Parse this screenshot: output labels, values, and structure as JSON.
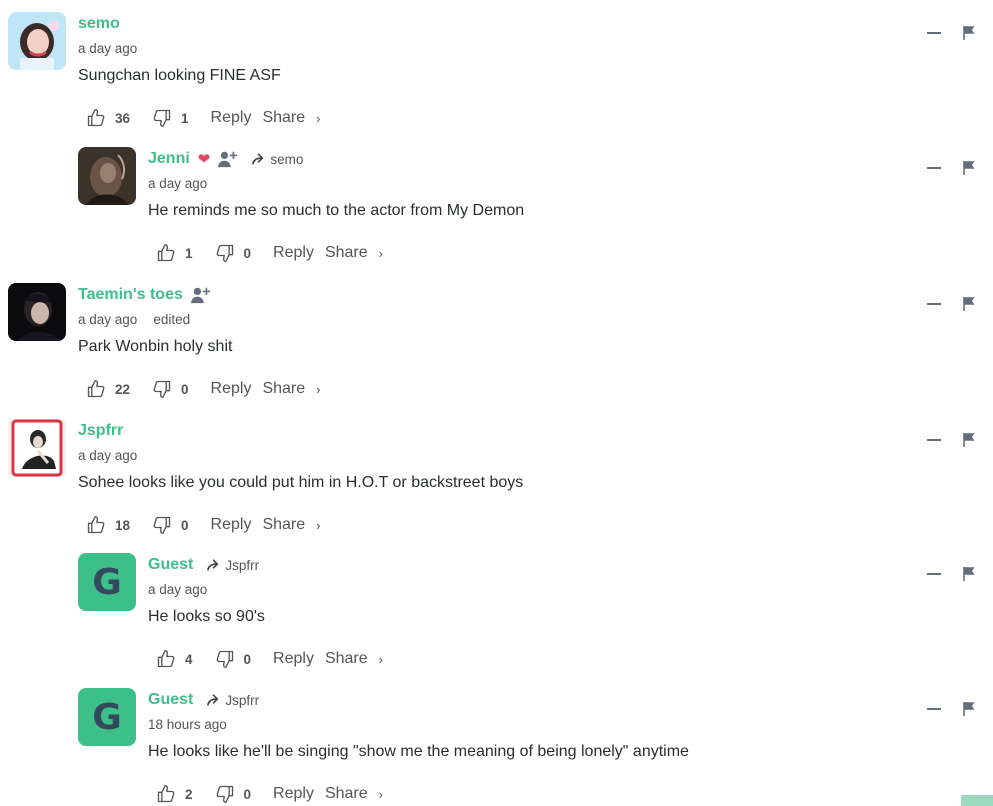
{
  "colors": {
    "author": "#3dbf8a",
    "text": "#2a2e2e",
    "muted": "#555555",
    "avatar_letter_bg": "#3dbf8a",
    "heart": "#e64563"
  },
  "labels": {
    "reply": "Reply",
    "share": "Share",
    "share_chevron": "›",
    "edited": "edited"
  },
  "comments": [
    {
      "author": "semo",
      "time": "a day ago",
      "text": "Sungchan looking FINE ASF",
      "likes": "36",
      "dislikes": "1",
      "avatar": "photo",
      "follow": false,
      "reply_to": ""
    },
    {
      "author": "Jenni",
      "badge": "❤",
      "time": "a day ago",
      "text": "He reminds me so much to the actor from My Demon",
      "likes": "1",
      "dislikes": "0",
      "avatar": "photo",
      "follow": true,
      "reply_to": "semo"
    },
    {
      "author": "Taemin's toes",
      "time": "a day ago",
      "edited": "edited",
      "text": "Park Wonbin holy shit",
      "likes": "22",
      "dislikes": "0",
      "avatar": "photo",
      "follow": true,
      "reply_to": ""
    },
    {
      "author": "Jspfrr",
      "time": "a day ago",
      "text": "Sohee looks like you could put him in H.O.T or backstreet boys",
      "likes": "18",
      "dislikes": "0",
      "avatar": "photo",
      "follow": false,
      "reply_to": ""
    },
    {
      "author": "Guest",
      "avatar_letter": "G",
      "time": "a day ago",
      "text": "He looks so 90's",
      "likes": "4",
      "dislikes": "0",
      "avatar": "letter",
      "follow": false,
      "reply_to": "Jspfrr"
    },
    {
      "author": "Guest",
      "avatar_letter": "G",
      "time": "18 hours ago",
      "text": "He looks like he'll be singing \"show me the meaning of being lonely\" anytime",
      "likes": "2",
      "dislikes": "0",
      "avatar": "letter",
      "follow": false,
      "reply_to": "Jspfrr"
    }
  ]
}
